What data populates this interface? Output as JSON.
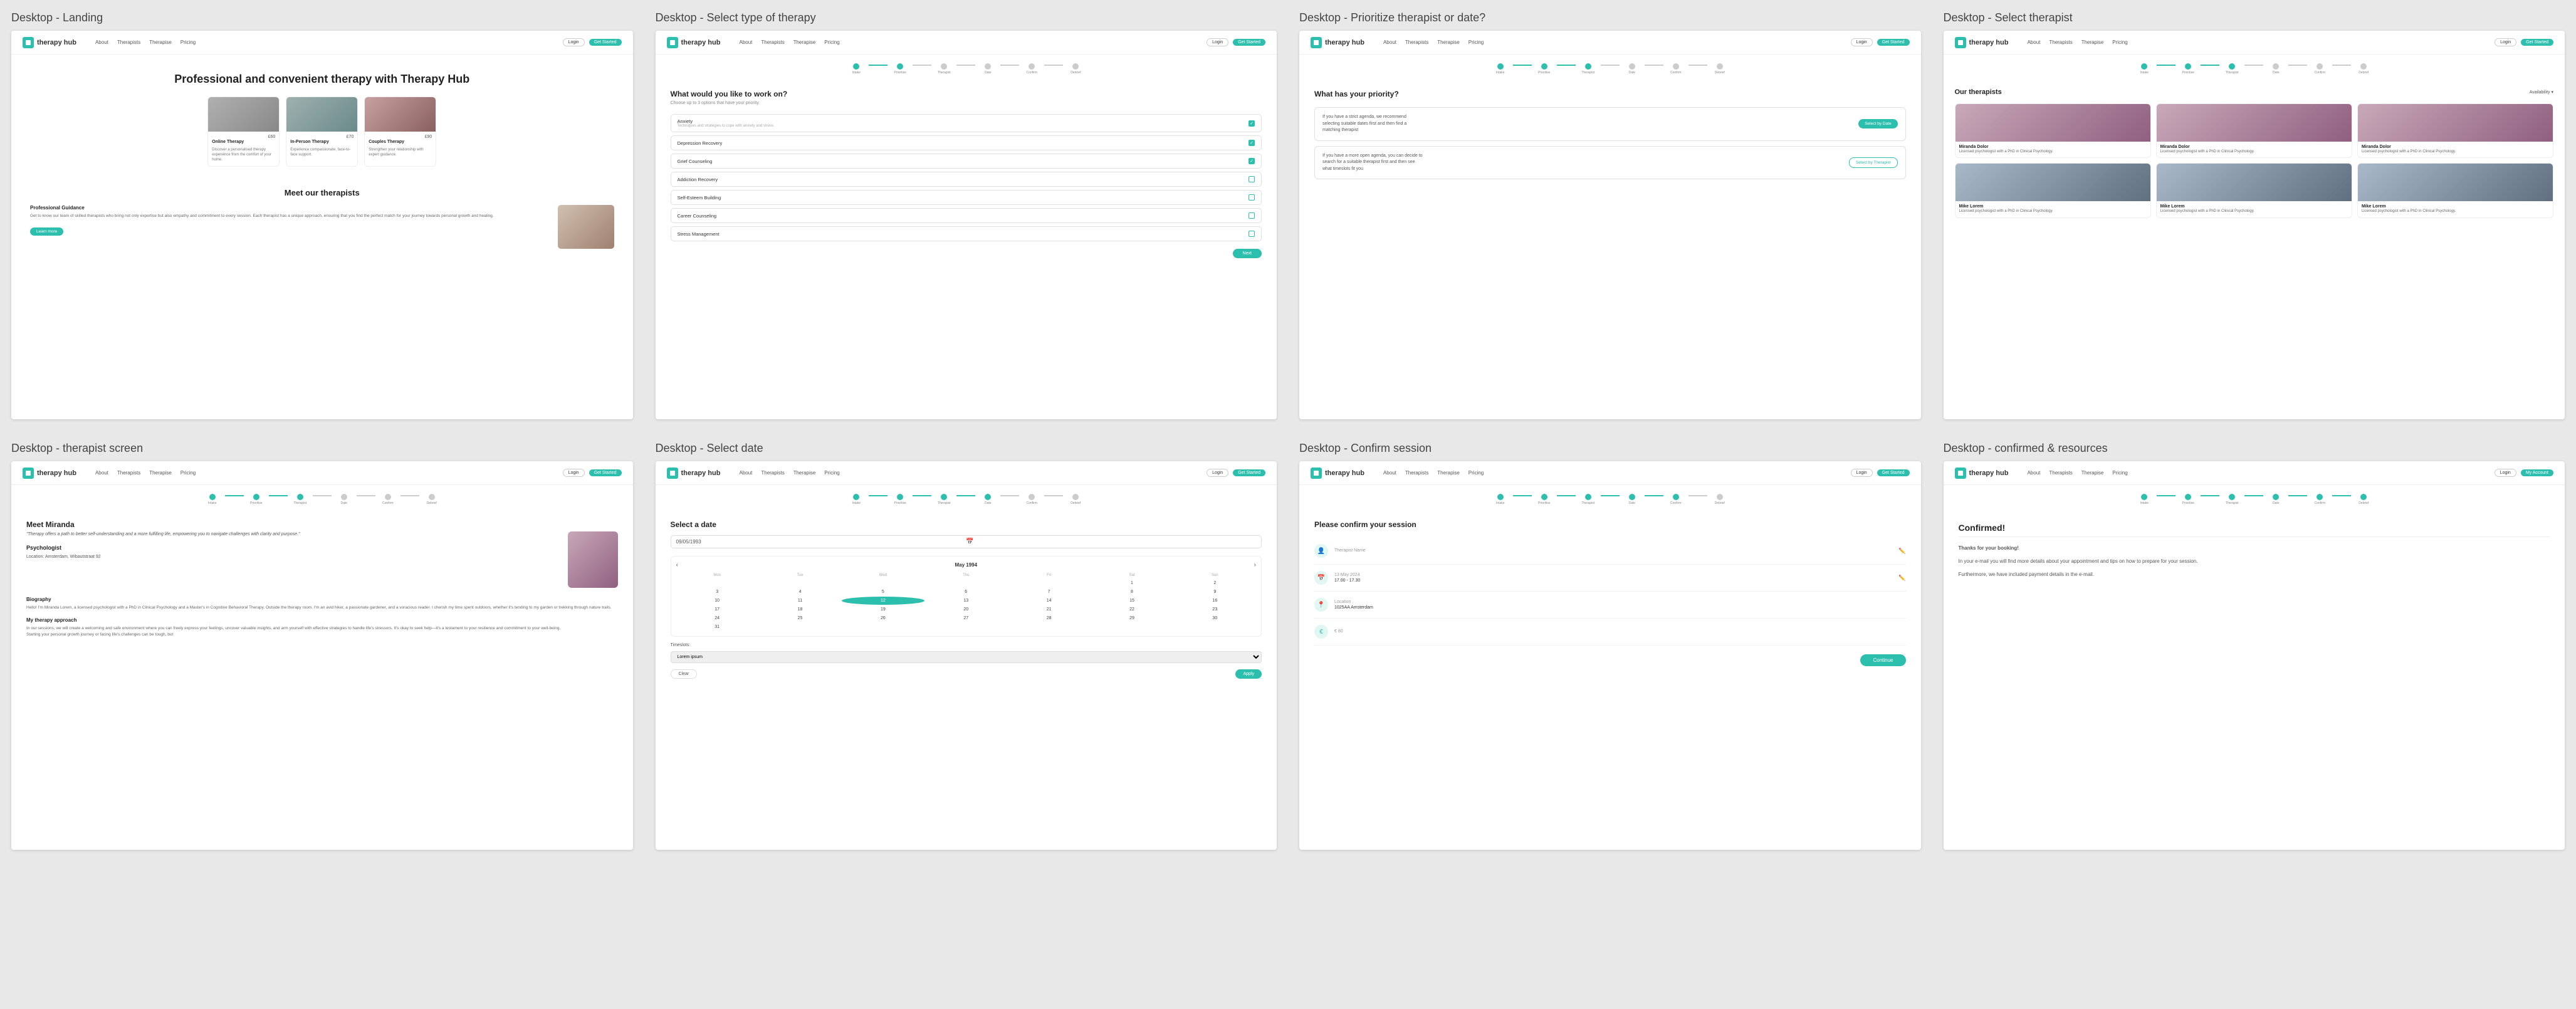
{
  "screens": [
    {
      "id": "landing",
      "label": "Desktop - Landing",
      "nav": {
        "logo": "therapy hub",
        "links": [
          "About",
          "Therapists",
          "Therapise",
          "Pricing"
        ],
        "login": "Login",
        "started": "Get Started"
      },
      "hero": {
        "title": "Professional and convenient therapy with Therapy Hub",
        "cards": [
          {
            "type": "Online Therapy",
            "price": "£60",
            "desc": "Discover a personalised therapy experience from the comfort of your home.",
            "imgClass": "img1"
          },
          {
            "type": "In-Person Therapy",
            "price": "£70",
            "desc": "Experience compassionate, face-to-face support.",
            "imgClass": "img2"
          },
          {
            "type": "Couples Therapy",
            "price": "£90",
            "desc": "Strengthen your relationship with expert guidance.",
            "imgClass": "img3"
          }
        ]
      },
      "meet": {
        "title": "Meet our therapists",
        "subtitle": "Professional Guidance",
        "body": "Get to know our team of skilled therapists who bring not only expertise but also empathy and commitment to every session. Each therapist has a unique approach, ensuring that you find the perfect match for your journey towards personal growth and healing.",
        "learnMore": "Learn more"
      }
    },
    {
      "id": "select-therapy",
      "label": "Desktop - Select type of therapy",
      "nav": {
        "logo": "therapy hub",
        "links": [
          "About",
          "Therapists",
          "Therapise",
          "Pricing"
        ],
        "login": "Login",
        "started": "Get Started"
      },
      "stepper": {
        "steps": [
          "Intake",
          "Prioritise/therapist",
          "Therapist",
          "Date",
          "Confirm",
          "Confirm",
          "Debrief"
        ],
        "active": 1
      },
      "title": "What would you like to work on?",
      "subtitle": "Choose up to 3 options that have your priority.",
      "options": [
        {
          "label": "Anxiety",
          "sublabel": "Techniques and strategies to cope with anxiety and stress.",
          "checked": true
        },
        {
          "label": "Depression Recovery",
          "checked": true
        },
        {
          "label": "Grief Counseling",
          "checked": true
        },
        {
          "label": "Addiction Recovery",
          "checked": false
        },
        {
          "label": "Self-Esteem Building",
          "checked": false
        },
        {
          "label": "Career Counseling",
          "checked": false
        },
        {
          "label": "Stress Management",
          "checked": false
        }
      ],
      "next": "Next"
    },
    {
      "id": "priority",
      "label": "Desktop - Prioritize therapist or date?",
      "nav": {
        "logo": "therapy hub",
        "links": [
          "About",
          "Therapists",
          "Therapise",
          "Pricing"
        ],
        "login": "Login",
        "started": "Get Started"
      },
      "stepper": {
        "steps": [
          "Intake",
          "Prioritise/therapist",
          "Therapist",
          "Date",
          "Confirm",
          "Confirm",
          "Debrief"
        ],
        "active": 2
      },
      "title": "What has your priority?",
      "options": [
        {
          "text": "If you have a strict agenda, we recommend selecting suitable dates first and then find a matching therapist",
          "btn": "Select by Date",
          "btnClass": "date"
        },
        {
          "text": "If you have a more open agenda, you can decide to search for a suitable therapist first and then see what timeslots fit you",
          "btn": "Select by Therapist",
          "btnClass": "therapist"
        }
      ]
    },
    {
      "id": "select-therapist",
      "label": "Desktop - Select therapist",
      "nav": {
        "logo": "therapy hub",
        "links": [
          "About",
          "Therapists",
          "Therapise",
          "Pricing"
        ],
        "login": "Login",
        "started": "Get Started"
      },
      "stepper": {
        "steps": [
          "Intake",
          "Prioritise/therapist",
          "Therapist",
          "Date",
          "Confirm",
          "Confirm",
          "Debrief"
        ],
        "active": 3
      },
      "title": "Our therapists",
      "filter": "Availability ▾",
      "therapists": [
        {
          "name": "Miranda Dolor",
          "role": "Licensed psychologist with a PhD in Clinical Psychology.",
          "gender": "female"
        },
        {
          "name": "Miranda Dolor",
          "role": "Licensed psychologist with a PhD in Clinical Psychology.",
          "gender": "female"
        },
        {
          "name": "Miranda Dolor",
          "role": "Licensed psychologist with a PhD in Clinical Psychology.",
          "gender": "female"
        },
        {
          "name": "Mike Lorem",
          "role": "Licensed psychologist with a PhD in Clinical Psychology.",
          "gender": "male"
        },
        {
          "name": "Mike Lorem",
          "role": "Licensed psychologist with a PhD in Clinical Psychology.",
          "gender": "male"
        },
        {
          "name": "Mike Lorem",
          "role": "Licensed psychologist with a PhD in Clinical Psychology.",
          "gender": "male"
        }
      ]
    },
    {
      "id": "therapist-screen",
      "label": "Desktop - therapist screen",
      "nav": {
        "logo": "therapy hub",
        "links": [
          "About",
          "Therapists",
          "Therapise",
          "Pricing"
        ],
        "login": "Login",
        "started": "Get Started"
      },
      "stepper": {
        "steps": [
          "Intake",
          "Prioritise/therapist",
          "Therapist",
          "Date",
          "Confirm",
          "Confirm",
          "Debrief"
        ],
        "active": 3
      },
      "therapist": {
        "name": "Meet Miranda",
        "quote": "\"Therapy offers a path to better self-understanding and a more fulfilling life, empowering you to navigate challenges with clarity and purpose.\"",
        "title": "Psychologist",
        "location": "Location:",
        "locationValue": "Amsterdam, Wibautstraat 92",
        "biography": "Biography",
        "bioText": "Hello! I'm Miranda Lorem, a licensed psychologist with a PhD in Clinical Psychology and a Master's in Cognitive Behavioral Therapy. Outside the therapy room, I'm an avid hiker, a passionate gardener, and a voracious reader. I cherish my time spent outdoors, whether it's tending to my garden or trekking through nature trails.",
        "approachTitle": "My therapy approach",
        "approachText": "In our sessions, we will create a welcoming and safe environment where you can freely express your feelings, uncover valuable insights, and arm yourself with effective strategies to handle life's stressors. It's okay to seek help—it's a testament to your resilience and commitment to your well-being.",
        "approachText2": "Starting your personal growth journey or facing life's challenges can be tough, but"
      }
    },
    {
      "id": "select-date",
      "label": "Desktop - Select date",
      "nav": {
        "logo": "therapy hub",
        "links": [
          "About",
          "Therapists",
          "Therapise",
          "Pricing"
        ],
        "login": "Login",
        "started": "Get Started"
      },
      "stepper": {
        "steps": [
          "Intake",
          "Prioritise/therapist",
          "Therapist",
          "Date",
          "Confirm",
          "Confirm",
          "Debrief"
        ],
        "active": 4
      },
      "title": "Select a date",
      "inputValue": "09/05/1993",
      "calendar": {
        "month": "May 1994",
        "days": [
          "Mon",
          "Tue",
          "Wed",
          "Thu",
          "Fri",
          "Sat",
          "Sun"
        ],
        "weeks": [
          [
            "",
            "",
            "",
            "",
            "",
            "1",
            "2"
          ],
          [
            "3",
            "4",
            "5",
            "6",
            "7",
            "8",
            "9"
          ],
          [
            "10",
            "11",
            "12",
            "13",
            "14",
            "15",
            "16"
          ],
          [
            "17",
            "18",
            "19",
            "20",
            "21",
            "22",
            "23"
          ],
          [
            "24",
            "25",
            "26",
            "27",
            "28",
            "29",
            "30"
          ],
          [
            "31",
            "",
            "",
            "",
            "",
            "",
            ""
          ]
        ],
        "today": "12",
        "selected": "12"
      },
      "timeslot": {
        "label": "Timeslots:",
        "placeholder": "Lorem ipsum"
      },
      "clear": "Clear",
      "apply": "Apply"
    },
    {
      "id": "confirm-session",
      "label": "Desktop - Confirm session",
      "nav": {
        "logo": "therapy hub",
        "links": [
          "About",
          "Therapists",
          "Therapise",
          "Pricing"
        ],
        "login": "Login",
        "started": "Get Started"
      },
      "stepper": {
        "steps": [
          "Intake",
          "Prioritise/therapist",
          "Therapist",
          "Date",
          "Confirm",
          "Confirm",
          "Debrief"
        ],
        "active": 5
      },
      "title": "Please confirm your session",
      "rows": [
        {
          "icon": "👤",
          "label": "Therapist Name",
          "value": ""
        },
        {
          "icon": "📅",
          "label": "13 May 2024",
          "value": "17.00 - 17.30"
        },
        {
          "icon": "📍",
          "label": "Location",
          "value": "1025AA Amsterdam"
        },
        {
          "icon": "💰",
          "label": "€ 80",
          "value": ""
        }
      ],
      "confirmBtn": "Continue"
    },
    {
      "id": "confirmed",
      "label": "Desktop - confirmed & resources",
      "nav": {
        "logo": "therapy hub",
        "links": [
          "About",
          "Therapists",
          "Therapise",
          "Pricing"
        ],
        "login": "Login",
        "started": "My Account"
      },
      "stepper": {
        "steps": [
          "Intake",
          "Prioritise/therapist",
          "Therapist",
          "Date",
          "Confirm",
          "Confirm",
          "Debrief"
        ],
        "active": 6
      },
      "title": "Confirmed!",
      "body1": "Thanks for your booking!",
      "body2": "In your e-mail you will find more details about your appointment and tips on how to prepare for your session.",
      "body3": "Furthermore, we have included payment details in the e-mail."
    }
  ]
}
